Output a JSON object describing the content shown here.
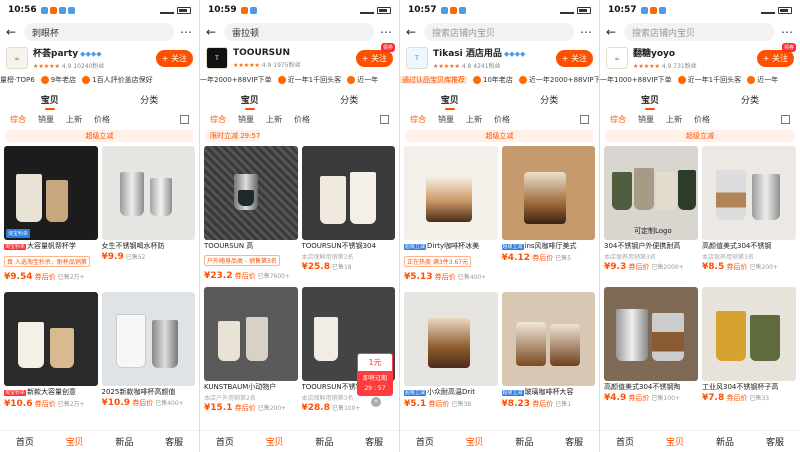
{
  "phones": [
    {
      "status": {
        "time": "10:56"
      },
      "search": {
        "query": "刺眼杯"
      },
      "store": {
        "name": "杯荟party",
        "logo_text": "",
        "rating": "4.9",
        "fans": "10240粉丝",
        "follow": "+ 关注",
        "badge": ""
      },
      "ticker": [
        "量榜·TOP6",
        "9年老店",
        "1百人評价盖店保好",
        "近一年..."
      ],
      "tabs": [
        "宝贝",
        "分类"
      ],
      "filters": [
        "综合",
        "销量",
        "上新",
        "价格"
      ],
      "chip": "超级立减",
      "products": [
        {
          "title_label": "淘宝秒杀",
          "title": "大容量帆帮杯学",
          "sub": "",
          "pill": "真 入选淘宝秒杀，耐杯品销第",
          "price": "¥9.54",
          "extra": "券后价",
          "sold": "已售2万+"
        },
        {
          "title_label": "",
          "title": "女生不锈钢喝水杯防",
          "sub": "",
          "pill": "",
          "price": "¥9.9",
          "extra": "",
          "sold": "已售52"
        },
        {
          "title_label": "淘宝秒杀",
          "title": "新款大容量创意",
          "sub": "",
          "pill": "",
          "price": "¥10.6",
          "extra": "券后价",
          "sold": "已售2万+"
        },
        {
          "title_label": "",
          "title": "2025新款咖啡杯高颜值",
          "sub": "",
          "pill": "",
          "price": "¥10.9",
          "extra": "券后价",
          "sold": "已售400+"
        }
      ],
      "nav": [
        "首页",
        "宝贝",
        "新品",
        "客服"
      ],
      "nav_active": 1
    },
    {
      "status": {
        "time": "10:59"
      },
      "search": {
        "query": "雷拉顿"
      },
      "store": {
        "name": "TOOURSUN",
        "logo_text": "TOOURSUN",
        "rating": "4.9",
        "fans": "1975粉丝",
        "follow": "+ 关注",
        "badge": "领券"
      },
      "ticker": [
        "一年2000+88VIP下单",
        "近一年1千回头客",
        "近一年"
      ],
      "tabs": [
        "宝贝",
        "分类"
      ],
      "filters": [
        "综合",
        "销量",
        "上新",
        "价格"
      ],
      "chip_left": "限时立减 29:57",
      "products": [
        {
          "title_label": "",
          "title": "TOOURSUN 高",
          "sub": "",
          "pill": "户外随身品类 - 销售第3名",
          "price": "¥23.2",
          "extra": "券后价",
          "sold": "已售7600+"
        },
        {
          "title_label": "",
          "title": "TOOURSUN不锈钢304",
          "sub": "本店保鲜用销第3名",
          "pill": "",
          "price": "¥25.8",
          "extra": "",
          "sold": "已售18"
        },
        {
          "title_label": "",
          "title": "KUNSTBAUM小动物户",
          "sub": "本店户外用销第2名",
          "pill": "",
          "price": "¥15.1",
          "extra": "券后价",
          "sold": "已售200+"
        },
        {
          "title_label": "",
          "title": "TOOURSUN不锈钢304",
          "sub": "本店保鲜用销第3名",
          "pill": "",
          "price": "¥28.8",
          "extra": "",
          "sold": "已售100+"
        }
      ],
      "coupons": [
        "满3件9.9折",
        "满3件9.9折"
      ],
      "float": {
        "top": "1元",
        "mid": "即将过期",
        "countdown": "29 : 57"
      },
      "nav": [
        "首页",
        "宝贝",
        "新品",
        "客服"
      ],
      "nav_active": 1
    },
    {
      "status": {
        "time": "10:57"
      },
      "search": {
        "query": "搜索店铺内宝贝"
      },
      "store": {
        "name": "Tikasi 酒店用品",
        "logo_text": "",
        "rating": "4.8",
        "fans": "4241粉丝",
        "follow": "+ 关注",
        "badge": ""
      },
      "ticker": [
        "通过认品宝贝库推荐",
        "10年老店",
        "近一年2000+88VIP下单"
      ],
      "tabs": [
        "宝贝",
        "分类"
      ],
      "filters": [
        "综合",
        "销量",
        "上新",
        "价格"
      ],
      "chip": "超级立减",
      "products": [
        {
          "title_label": "超级立减",
          "title": "Dirty咖啡杯冰美",
          "sub": "",
          "pill": "正在热卖 满3件3.67元",
          "price": "¥5.13",
          "extra": "券后价",
          "sold": "已售400+"
        },
        {
          "title_label": "超级立减",
          "title": "ins风咖啡厅美式",
          "sub": "",
          "pill": "",
          "price": "¥4.12",
          "extra": "券后价",
          "sold": "已售5"
        },
        {
          "title_label": "超级立减",
          "title": "小众耐高温Drit",
          "sub": "",
          "pill": "",
          "price": "¥5.1",
          "extra": "券后价",
          "sold": "已售38"
        },
        {
          "title_label": "超级立减",
          "title": "玻璃咖啡杯大容",
          "sub": "",
          "pill": "",
          "price": "¥8.23",
          "extra": "券后价",
          "sold": "已售1"
        }
      ],
      "nav": [
        "首页",
        "宝贝",
        "新品",
        "客服"
      ],
      "nav_active": 1
    },
    {
      "status": {
        "time": "10:57"
      },
      "search": {
        "query": "搜索店铺内宝贝"
      },
      "store": {
        "name": "翻糖yoyo",
        "logo_text": "",
        "rating": "4.9",
        "fans": "731粉丝",
        "follow": "+ 关注",
        "badge": "领券"
      },
      "ticker": [
        "一年1000+88VIP下单",
        "近一年1千回头客",
        "近一年"
      ],
      "tabs": [
        "宝贝",
        "分类"
      ],
      "filters": [
        "综合",
        "销量",
        "上新",
        "价格"
      ],
      "chip": "超级立减",
      "products": [
        {
          "title_label": "",
          "title": "304不锈钢户外便携耐高",
          "sub": "本店保养用销第3名",
          "pill": "",
          "price": "¥9.3",
          "extra": "券后价",
          "sold": "已售2000+"
        },
        {
          "title_label": "",
          "title": "高颜值美式304不锈钢",
          "sub": "本店保养用销第3名",
          "pill": "",
          "price": "¥8.5",
          "extra": "券后价",
          "sold": "已售200+"
        },
        {
          "title_label": "",
          "title": "高颜值美式304不锈钢陶",
          "sub": "",
          "pill": "",
          "price": "¥4.9",
          "extra": "券后价",
          "sold": "已售100+"
        },
        {
          "title_label": "",
          "title": "工业风304不锈钢杯子高",
          "sub": "",
          "pill": "",
          "price": "¥7.8",
          "extra": "券后价",
          "sold": "已售33"
        }
      ],
      "coupons": [
        "满3件9.5折",
        "满3件9.5折"
      ],
      "image_caption": "可定制Logo",
      "nav": [
        "首页",
        "宝贝",
        "新品",
        "客服"
      ],
      "nav_active": 1
    }
  ]
}
